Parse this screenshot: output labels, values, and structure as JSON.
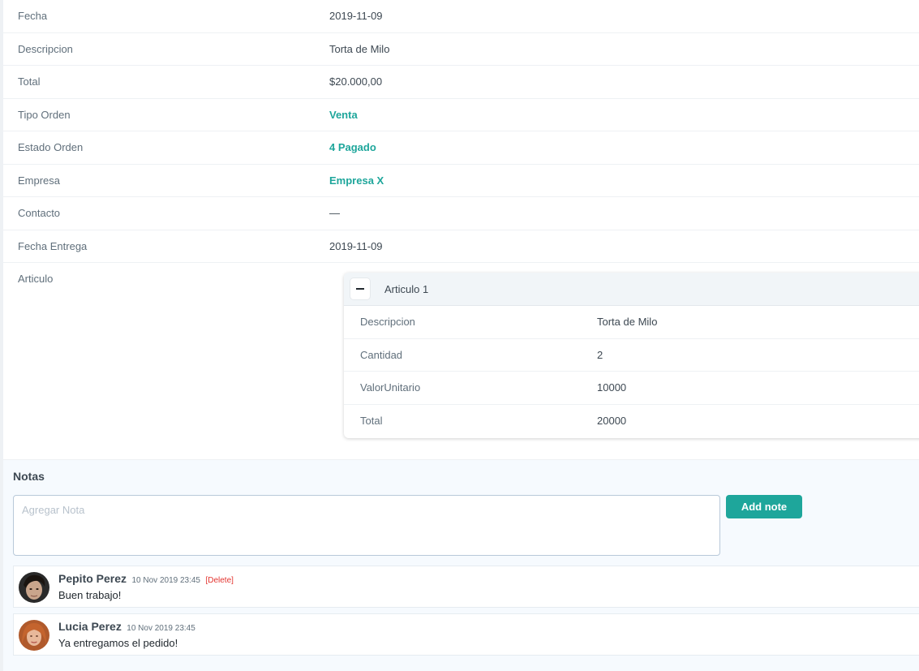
{
  "details": [
    {
      "label": "Fecha",
      "value": "2019-11-09"
    },
    {
      "label": "Descripcion",
      "value": "Torta de Milo"
    },
    {
      "label": "Total",
      "value": "$20.000,00"
    },
    {
      "label": "Tipo Orden",
      "value": "Venta"
    },
    {
      "label": "Estado Orden",
      "value": "4 Pagado"
    },
    {
      "label": "Empresa",
      "value": "Empresa X"
    },
    {
      "label": "Contacto",
      "value": "—"
    },
    {
      "label": "Fecha Entrega",
      "value": "2019-11-09"
    }
  ],
  "articulo": {
    "label": "Articulo",
    "card_title": "Articulo 1",
    "toggle_icon": "minus-icon",
    "rows": [
      {
        "label": "Descripcion",
        "value": "Torta de Milo"
      },
      {
        "label": "Cantidad",
        "value": "2"
      },
      {
        "label": "ValorUnitario",
        "value": "10000"
      },
      {
        "label": "Total",
        "value": "20000"
      }
    ]
  },
  "notes": {
    "title": "Notas",
    "placeholder": "Agregar Nota",
    "add_button": "Add note",
    "items": [
      {
        "author": "Pepito Perez",
        "time": "10 Nov 2019 23:45",
        "delete": "[Delete]",
        "text": "Buen trabajo!"
      },
      {
        "author": "Lucia Perez",
        "time": "10 Nov 2019 23:45",
        "text": "Ya entregamos el pedido!"
      }
    ]
  },
  "colors": {
    "accent": "#1ea69b",
    "danger": "#e3342f",
    "notes_bg": "#f6fafe"
  }
}
